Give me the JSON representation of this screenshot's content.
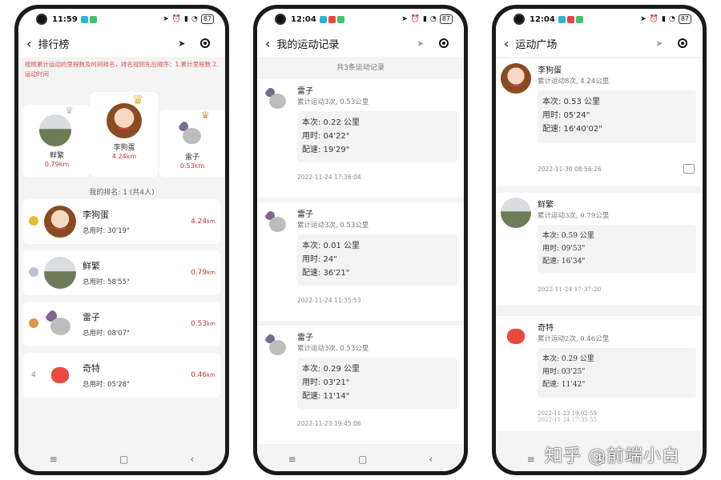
{
  "status": {
    "p1_time": "11:59",
    "p2_time": "12:04",
    "p3_time": "12:04",
    "battery": "87"
  },
  "screen1": {
    "title": "排行榜",
    "rule_note": "按照累计运动的里程数及时间排名，排名规则先后顺序：1.累计里程数 2.运动时间",
    "podium": [
      {
        "name": "鲜繁",
        "km": "0.79km",
        "place": 2
      },
      {
        "name": "李狗蛋",
        "km": "4.24km",
        "place": 1
      },
      {
        "name": "雷子",
        "km": "0.53km",
        "place": 3
      }
    ],
    "my_rank": "我的排名: 1 (共4人)",
    "rows": [
      {
        "rank": "1",
        "name": "李狗蛋",
        "time": "总用时: 30'19\"",
        "km": "4.24",
        "unit": "km",
        "avatar": "girl"
      },
      {
        "rank": "2",
        "name": "鲜繁",
        "time": "总用时: 58'55\"",
        "km": "0.79",
        "unit": "km",
        "avatar": "land"
      },
      {
        "rank": "3",
        "name": "雷子",
        "time": "总用时: 08'07\"",
        "km": "0.53",
        "unit": "km",
        "avatar": "mouse"
      },
      {
        "rank": "4",
        "name": "奇特",
        "time": "总用时: 05'28\"",
        "km": "0.46",
        "unit": "km",
        "avatar": "pig"
      }
    ]
  },
  "screen2": {
    "title": "我的运动记录",
    "count": "共3条运动记录",
    "records": [
      {
        "name": "雷子",
        "total": "累计运动3次, 0.53公里",
        "dist": "本次: 0.22 公里",
        "used": "用时: 04'22\"",
        "pace": "配速: 19'29\"",
        "date": "2022-11-24 17:36:04"
      },
      {
        "name": "雷子",
        "total": "累计运动3次, 0.53公里",
        "dist": "本次: 0.01 公里",
        "used": "用时: 24\"",
        "pace": "配速: 36'21\"",
        "date": "2022-11-24 11:35:53"
      },
      {
        "name": "雷子",
        "total": "累计运动3次, 0.53公里",
        "dist": "本次: 0.29 公里",
        "used": "用时: 03'21\"",
        "pace": "配速: 11'14\"",
        "date": "2022-11-23 19:45:06"
      }
    ]
  },
  "screen3": {
    "title": "运动广场",
    "posts": [
      {
        "name": "李狗蛋",
        "total": "累计运动8次, 4.24公里",
        "dist": "本次: 0.53 公里",
        "used": "用时: 05'24\"",
        "pace": "配速: 16'40'02\"",
        "date": "2022-11-30 08:56:26"
      },
      {
        "name": "鲜繁",
        "total": "累计运动3次, 0.79公里",
        "dist": "本次: 0.59 公里",
        "used": "用时: 09'53\"",
        "pace": "配速: 16'34\"",
        "date": "2022-11-24 17:37:20"
      },
      {
        "name": "奇特",
        "total": "累计运动2次, 0.46公里",
        "dist": "本次: 0.29 公里",
        "used": "用时: 03'25\"",
        "pace": "配速: 11'42\"",
        "date": "2022-11-23 19:02:59",
        "date2": "2022-11-24 17:35:55"
      }
    ]
  },
  "watermark": "知乎 @前端小白",
  "colors": {
    "accent_red": "#c0392b",
    "note_red": "#d9534f",
    "gold": "#e8b93a",
    "silver": "#b8c4d6",
    "bronze": "#d79b4c"
  }
}
